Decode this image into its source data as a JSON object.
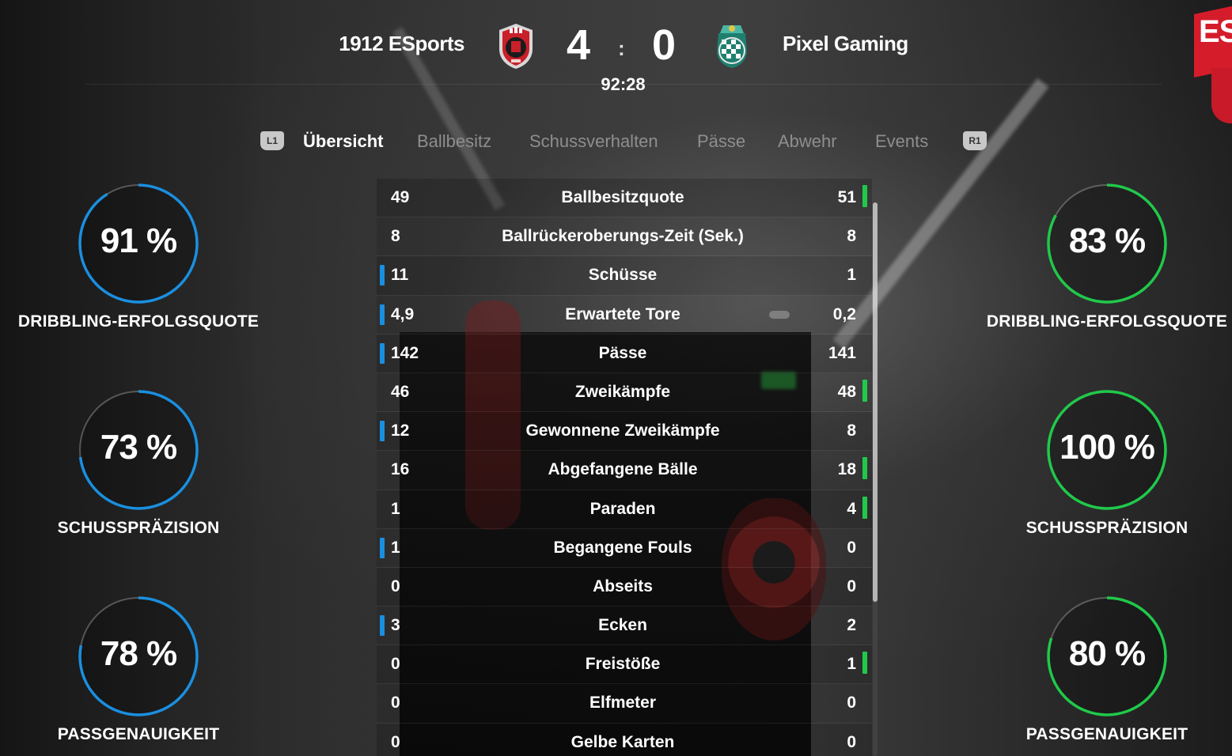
{
  "match": {
    "home_team": "1912 ESports",
    "away_team": "Pixel Gaming",
    "home_score": "4",
    "away_score": "0",
    "separator": ":",
    "clock": "92:28"
  },
  "corner_logo": {
    "text": "ES",
    "color": "#d51c2b"
  },
  "tabs": {
    "left_button": "L1",
    "right_button": "R1",
    "items": [
      {
        "label": "Übersicht",
        "active": true
      },
      {
        "label": "Ballbesitz",
        "active": false
      },
      {
        "label": "Schussverhalten",
        "active": false
      },
      {
        "label": "Pässe",
        "active": false
      },
      {
        "label": "Abwehr",
        "active": false
      },
      {
        "label": "Events",
        "active": false
      }
    ]
  },
  "colors": {
    "home_accent": "#1a8fe0",
    "away_accent": "#20c94a",
    "inactive_tab": "#8e8e8e"
  },
  "rings": {
    "home": [
      {
        "value": "91 %",
        "percent": 91,
        "label": "DRIBBLING-ERFOLGSQUOTE"
      },
      {
        "value": "73 %",
        "percent": 73,
        "label": "SCHUSSPRÄZISION"
      },
      {
        "value": "78 %",
        "percent": 78,
        "label": "PASSGENAUIGKEIT"
      }
    ],
    "away": [
      {
        "value": "83 %",
        "percent": 83,
        "label": "DRIBBLING-ERFOLGSQUOTE"
      },
      {
        "value": "100 %",
        "percent": 100,
        "label": "SCHUSSPRÄZISION"
      },
      {
        "value": "80 %",
        "percent": 80,
        "label": "PASSGENAUIGKEIT"
      }
    ]
  },
  "stats": [
    {
      "home": "49",
      "label": "Ballbesitzquote",
      "away": "51",
      "leader": "away"
    },
    {
      "home": "8",
      "label": "Ballrückeroberungs-Zeit (Sek.)",
      "away": "8",
      "leader": "none"
    },
    {
      "home": "11",
      "label": "Schüsse",
      "away": "1",
      "leader": "home"
    },
    {
      "home": "4,9",
      "label": "Erwartete Tore",
      "away": "0,2",
      "leader": "home"
    },
    {
      "home": "142",
      "label": "Pässe",
      "away": "141",
      "leader": "home"
    },
    {
      "home": "46",
      "label": "Zweikämpfe",
      "away": "48",
      "leader": "away"
    },
    {
      "home": "12",
      "label": "Gewonnene Zweikämpfe",
      "away": "8",
      "leader": "home"
    },
    {
      "home": "16",
      "label": "Abgefangene Bälle",
      "away": "18",
      "leader": "away"
    },
    {
      "home": "1",
      "label": "Paraden",
      "away": "4",
      "leader": "away"
    },
    {
      "home": "1",
      "label": "Begangene Fouls",
      "away": "0",
      "leader": "home"
    },
    {
      "home": "0",
      "label": "Abseits",
      "away": "0",
      "leader": "none"
    },
    {
      "home": "3",
      "label": "Ecken",
      "away": "2",
      "leader": "home"
    },
    {
      "home": "0",
      "label": "Freistöße",
      "away": "1",
      "leader": "away"
    },
    {
      "home": "0",
      "label": "Elfmeter",
      "away": "0",
      "leader": "none"
    },
    {
      "home": "0",
      "label": "Gelbe Karten",
      "away": "0",
      "leader": "none"
    }
  ]
}
